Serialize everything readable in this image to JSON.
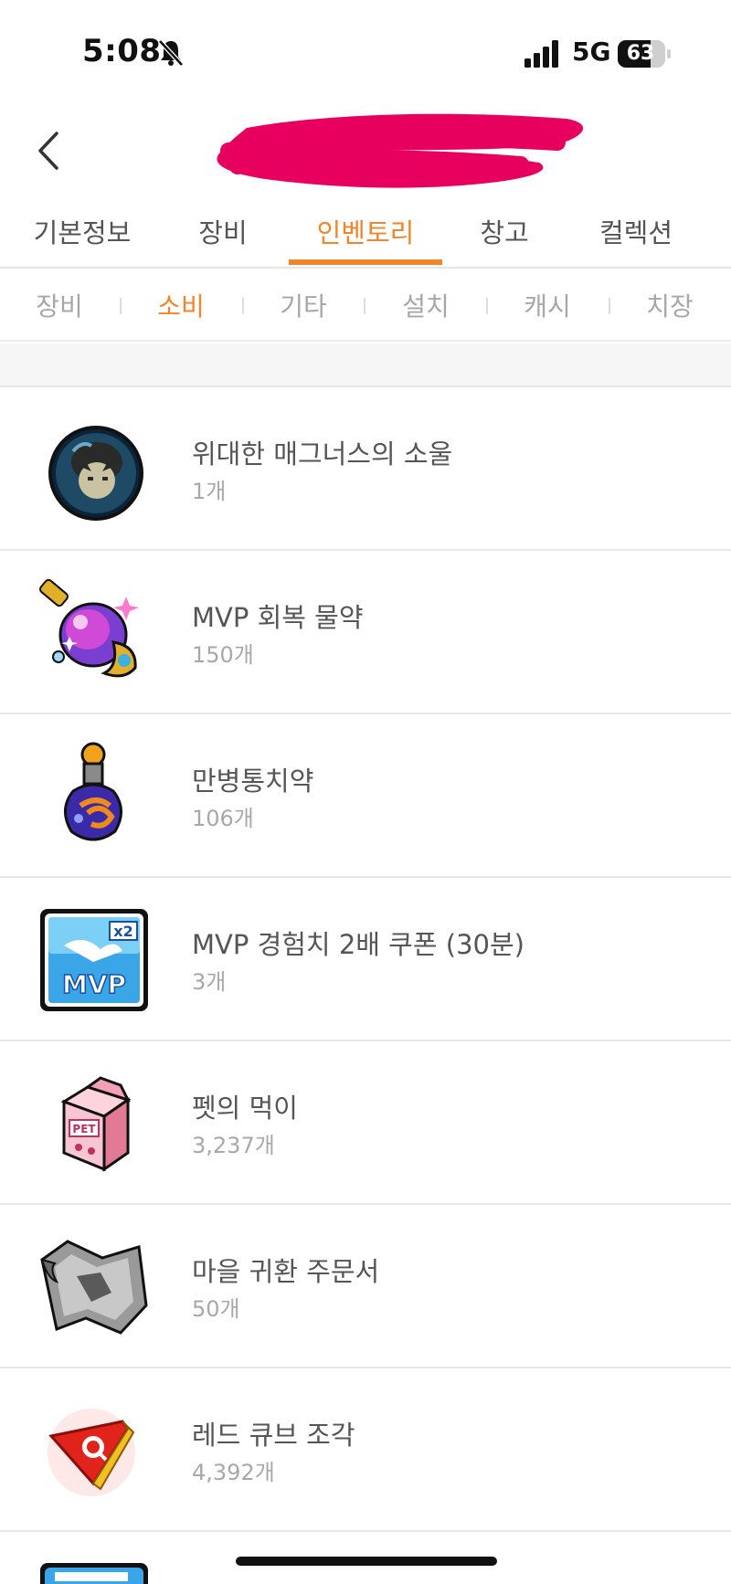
{
  "status_bar": {
    "time": "5:08",
    "network": "5G",
    "battery": "63"
  },
  "header": {
    "back_icon": "chevron-left-icon",
    "title_redacted": true
  },
  "main_tabs": [
    {
      "label": "기본정보",
      "active": false
    },
    {
      "label": "장비",
      "active": false
    },
    {
      "label": "인벤토리",
      "active": true
    },
    {
      "label": "창고",
      "active": false
    },
    {
      "label": "컬렉션",
      "active": false
    }
  ],
  "sub_tabs": [
    {
      "label": "장비",
      "active": false
    },
    {
      "label": "소비",
      "active": true
    },
    {
      "label": "기타",
      "active": false
    },
    {
      "label": "설치",
      "active": false
    },
    {
      "label": "캐시",
      "active": false
    },
    {
      "label": "치장",
      "active": false
    }
  ],
  "items": [
    {
      "name": "위대한 매그너스의 소울",
      "count": "1개",
      "icon": "magnus-soul-icon"
    },
    {
      "name": "MVP 회복 물약",
      "count": "150개",
      "icon": "mvp-potion-icon"
    },
    {
      "name": "만병통치약",
      "count": "106개",
      "icon": "all-cure-potion-icon"
    },
    {
      "name": "MVP 경험치 2배 쿠폰 (30분)",
      "count": "3개",
      "icon": "mvp-exp-coupon-icon"
    },
    {
      "name": "펫의 먹이",
      "count": "3,237개",
      "icon": "pet-food-icon"
    },
    {
      "name": "마을 귀환 주문서",
      "count": "50개",
      "icon": "return-scroll-icon"
    },
    {
      "name": "레드 큐브 조각",
      "count": "4,392개",
      "icon": "red-cube-fragment-icon"
    }
  ],
  "colors": {
    "accent": "#f0852c",
    "redaction": "#e8005f"
  }
}
